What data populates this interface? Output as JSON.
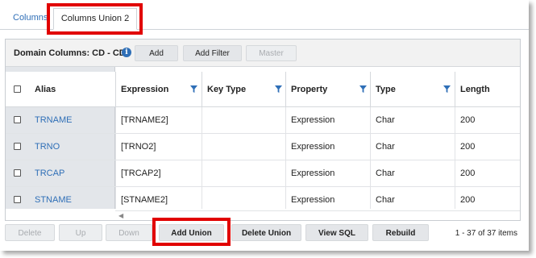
{
  "tabs": [
    {
      "label": "Columns"
    },
    {
      "label": "Columns Union 2"
    }
  ],
  "toolbar": {
    "domain_label": "Domain Columns: CD - CD",
    "info_icon": "info-icon",
    "add_label": "Add",
    "add_filter_label": "Add Filter",
    "master_label": "Master"
  },
  "grid": {
    "columns": [
      "Alias",
      "Expression",
      "Key Type",
      "Property",
      "Type",
      "Length"
    ],
    "rows": [
      {
        "alias": "TRNAME",
        "expression": "[TRNAME2]",
        "key_type": "",
        "property": "Expression",
        "type": "Char",
        "length": "200"
      },
      {
        "alias": "TRNO",
        "expression": "[TRNO2]",
        "key_type": "",
        "property": "Expression",
        "type": "Char",
        "length": "200"
      },
      {
        "alias": "TRCAP",
        "expression": "[TRCAP2]",
        "key_type": "",
        "property": "Expression",
        "type": "Char",
        "length": "200"
      },
      {
        "alias": "STNAME",
        "expression": "[STNAME2]",
        "key_type": "",
        "property": "Expression",
        "type": "Char",
        "length": "200"
      }
    ],
    "scroll_left_icon": "scroll-left-icon"
  },
  "bottom": {
    "delete_label": "Delete",
    "up_label": "Up",
    "down_label": "Down",
    "add_union_label": "Add Union",
    "delete_union_label": "Delete Union",
    "view_sql_label": "View SQL",
    "rebuild_label": "Rebuild",
    "count_text": "1 - 37 of 37 items"
  },
  "colors": {
    "link": "#2f6fb7",
    "highlight": "#e10000",
    "filter_icon": "#2f6fb7",
    "frozen_bg": "#e3e6ea"
  }
}
